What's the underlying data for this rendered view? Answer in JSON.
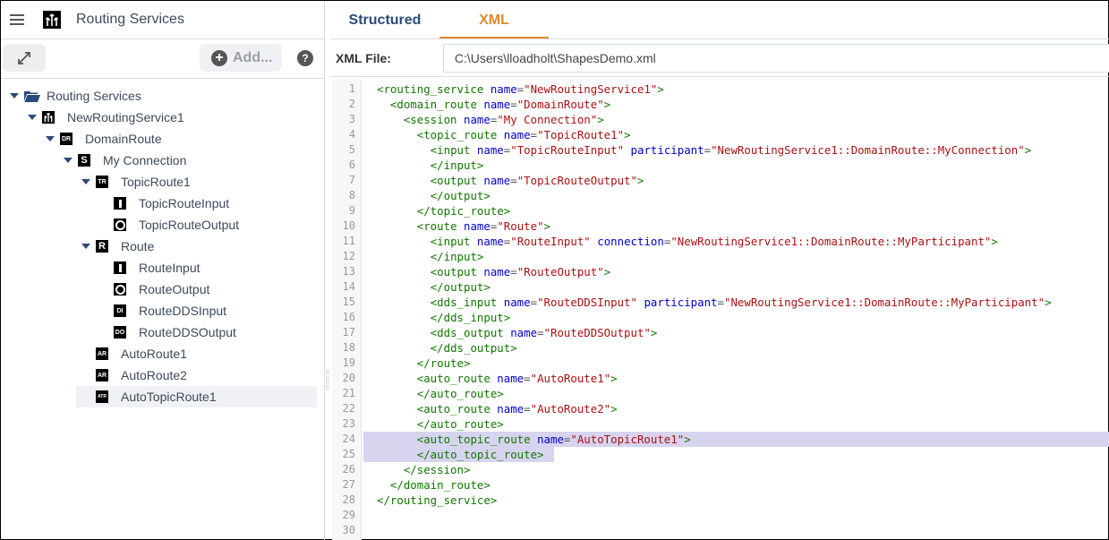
{
  "app": {
    "title": "Routing Services",
    "menu_icon": "hamburger-icon",
    "logo_icon": "routing-service-icon"
  },
  "toolbar": {
    "expand_icon": "expand-diagonal-icon",
    "add_label": "Add...",
    "add_icon": "plus-circle-icon",
    "help_icon": "question-icon",
    "help_glyph": "?",
    "add_glyph": "+"
  },
  "tree": [
    {
      "label": "Routing Services",
      "icon": "folder-open-icon",
      "badge": "",
      "expanded": true,
      "depth": 0
    },
    {
      "label": "NewRoutingService1",
      "icon": "routing-service-icon",
      "badge": "",
      "expanded": true,
      "depth": 1
    },
    {
      "label": "DomainRoute",
      "icon": "domain-route-icon",
      "badge": "DR",
      "expanded": true,
      "depth": 2
    },
    {
      "label": "My Connection",
      "icon": "session-icon",
      "badge": "S",
      "expanded": true,
      "depth": 3
    },
    {
      "label": "TopicRoute1",
      "icon": "topic-route-icon",
      "badge": "TR",
      "expanded": true,
      "depth": 4
    },
    {
      "label": "TopicRouteInput",
      "icon": "input-icon",
      "badge": "I",
      "depth": 5
    },
    {
      "label": "TopicRouteOutput",
      "icon": "output-icon",
      "badge": "O",
      "depth": 5
    },
    {
      "label": "Route",
      "icon": "route-icon",
      "badge": "R",
      "expanded": true,
      "depth": 4
    },
    {
      "label": "RouteInput",
      "icon": "input-icon",
      "badge": "I",
      "depth": 5
    },
    {
      "label": "RouteOutput",
      "icon": "output-icon",
      "badge": "O",
      "depth": 5
    },
    {
      "label": "RouteDDSInput",
      "icon": "dds-input-icon",
      "badge": "DI",
      "depth": 5
    },
    {
      "label": "RouteDDSOutput",
      "icon": "dds-output-icon",
      "badge": "DO",
      "depth": 5
    },
    {
      "label": "AutoRoute1",
      "icon": "auto-route-icon",
      "badge": "AR",
      "depth": 4
    },
    {
      "label": "AutoRoute2",
      "icon": "auto-route-icon",
      "badge": "AR",
      "depth": 4
    },
    {
      "label": "AutoTopicRoute1",
      "icon": "auto-topic-route-icon",
      "badge": "ATR",
      "depth": 4,
      "selected": true
    }
  ],
  "tabs": [
    {
      "label": "Structured",
      "active": false
    },
    {
      "label": "XML",
      "active": true
    }
  ],
  "file": {
    "label": "XML File:",
    "value": "C:\\Users\\lloadholt\\ShapesDemo.xml"
  },
  "editor": {
    "highlight_lines": [
      24,
      25
    ],
    "lines": [
      {
        "n": "1",
        "indent": 0,
        "tokens": [
          [
            "tg",
            "<routing_service"
          ],
          [
            "pn",
            " "
          ],
          [
            "at",
            "name"
          ],
          [
            "pn",
            "="
          ],
          [
            "st",
            "\"NewRoutingService1\""
          ],
          [
            "tg",
            ">"
          ]
        ]
      },
      {
        "n": "2",
        "indent": 1,
        "tokens": [
          [
            "tg",
            "<domain_route"
          ],
          [
            "pn",
            " "
          ],
          [
            "at",
            "name"
          ],
          [
            "pn",
            "="
          ],
          [
            "st",
            "\"DomainRoute\""
          ],
          [
            "tg",
            ">"
          ]
        ]
      },
      {
        "n": "3",
        "indent": 2,
        "tokens": [
          [
            "tg",
            "<session"
          ],
          [
            "pn",
            " "
          ],
          [
            "at",
            "name"
          ],
          [
            "pn",
            "="
          ],
          [
            "st",
            "\"My Connection\""
          ],
          [
            "tg",
            ">"
          ]
        ]
      },
      {
        "n": "4",
        "indent": 3,
        "tokens": [
          [
            "tg",
            "<topic_route"
          ],
          [
            "pn",
            " "
          ],
          [
            "at",
            "name"
          ],
          [
            "pn",
            "="
          ],
          [
            "st",
            "\"TopicRoute1\""
          ],
          [
            "tg",
            ">"
          ]
        ]
      },
      {
        "n": "5",
        "indent": 4,
        "tokens": [
          [
            "tg",
            "<input"
          ],
          [
            "pn",
            " "
          ],
          [
            "at",
            "name"
          ],
          [
            "pn",
            "="
          ],
          [
            "st",
            "\"TopicRouteInput\""
          ],
          [
            "pn",
            " "
          ],
          [
            "at",
            "participant"
          ],
          [
            "pn",
            "="
          ],
          [
            "st",
            "\"NewRoutingService1::DomainRoute::MyConnection\""
          ],
          [
            "tg",
            ">"
          ]
        ]
      },
      {
        "n": "6",
        "indent": 4,
        "tokens": [
          [
            "tg",
            "</input>"
          ]
        ]
      },
      {
        "n": "7",
        "indent": 4,
        "tokens": [
          [
            "tg",
            "<output"
          ],
          [
            "pn",
            " "
          ],
          [
            "at",
            "name"
          ],
          [
            "pn",
            "="
          ],
          [
            "st",
            "\"TopicRouteOutput\""
          ],
          [
            "tg",
            ">"
          ]
        ]
      },
      {
        "n": "8",
        "indent": 4,
        "tokens": [
          [
            "tg",
            "</output>"
          ]
        ]
      },
      {
        "n": "9",
        "indent": 3,
        "tokens": [
          [
            "tg",
            "</topic_route>"
          ]
        ]
      },
      {
        "n": "10",
        "indent": 3,
        "tokens": [
          [
            "tg",
            "<route"
          ],
          [
            "pn",
            " "
          ],
          [
            "at",
            "name"
          ],
          [
            "pn",
            "="
          ],
          [
            "st",
            "\"Route\""
          ],
          [
            "tg",
            ">"
          ]
        ]
      },
      {
        "n": "11",
        "indent": 4,
        "tokens": [
          [
            "tg",
            "<input"
          ],
          [
            "pn",
            " "
          ],
          [
            "at",
            "name"
          ],
          [
            "pn",
            "="
          ],
          [
            "st",
            "\"RouteInput\""
          ],
          [
            "pn",
            " "
          ],
          [
            "at",
            "connection"
          ],
          [
            "pn",
            "="
          ],
          [
            "st",
            "\"NewRoutingService1::DomainRoute::MyParticipant\""
          ],
          [
            "tg",
            ">"
          ]
        ]
      },
      {
        "n": "12",
        "indent": 4,
        "tokens": [
          [
            "tg",
            "</input>"
          ]
        ]
      },
      {
        "n": "13",
        "indent": 4,
        "tokens": [
          [
            "tg",
            "<output"
          ],
          [
            "pn",
            " "
          ],
          [
            "at",
            "name"
          ],
          [
            "pn",
            "="
          ],
          [
            "st",
            "\"RouteOutput\""
          ],
          [
            "tg",
            ">"
          ]
        ]
      },
      {
        "n": "14",
        "indent": 4,
        "tokens": [
          [
            "tg",
            "</output>"
          ]
        ]
      },
      {
        "n": "15",
        "indent": 4,
        "tokens": [
          [
            "tg",
            "<dds_input"
          ],
          [
            "pn",
            " "
          ],
          [
            "at",
            "name"
          ],
          [
            "pn",
            "="
          ],
          [
            "st",
            "\"RouteDDSInput\""
          ],
          [
            "pn",
            " "
          ],
          [
            "at",
            "participant"
          ],
          [
            "pn",
            "="
          ],
          [
            "st",
            "\"NewRoutingService1::DomainRoute::MyParticipant\""
          ],
          [
            "tg",
            ">"
          ]
        ]
      },
      {
        "n": "16",
        "indent": 4,
        "tokens": [
          [
            "tg",
            "</dds_input>"
          ]
        ]
      },
      {
        "n": "17",
        "indent": 4,
        "tokens": [
          [
            "tg",
            "<dds_output"
          ],
          [
            "pn",
            " "
          ],
          [
            "at",
            "name"
          ],
          [
            "pn",
            "="
          ],
          [
            "st",
            "\"RouteDDSOutput\""
          ],
          [
            "tg",
            ">"
          ]
        ]
      },
      {
        "n": "18",
        "indent": 4,
        "tokens": [
          [
            "tg",
            "</dds_output>"
          ]
        ]
      },
      {
        "n": "19",
        "indent": 3,
        "tokens": [
          [
            "tg",
            "</route>"
          ]
        ]
      },
      {
        "n": "20",
        "indent": 3,
        "tokens": [
          [
            "tg",
            "<auto_route"
          ],
          [
            "pn",
            " "
          ],
          [
            "at",
            "name"
          ],
          [
            "pn",
            "="
          ],
          [
            "st",
            "\"AutoRoute1\""
          ],
          [
            "tg",
            ">"
          ]
        ]
      },
      {
        "n": "21",
        "indent": 3,
        "tokens": [
          [
            "tg",
            "</auto_route>"
          ]
        ]
      },
      {
        "n": "22",
        "indent": 3,
        "tokens": [
          [
            "tg",
            "<auto_route"
          ],
          [
            "pn",
            " "
          ],
          [
            "at",
            "name"
          ],
          [
            "pn",
            "="
          ],
          [
            "st",
            "\"AutoRoute2\""
          ],
          [
            "tg",
            ">"
          ]
        ]
      },
      {
        "n": "23",
        "indent": 3,
        "tokens": [
          [
            "tg",
            "</auto_route>"
          ]
        ]
      },
      {
        "n": "24",
        "indent": 3,
        "tokens": [
          [
            "tg",
            "<auto_topic_route"
          ],
          [
            "pn",
            " "
          ],
          [
            "at",
            "name"
          ],
          [
            "pn",
            "="
          ],
          [
            "st",
            "\"AutoTopicRoute1\""
          ],
          [
            "tg",
            ">"
          ]
        ]
      },
      {
        "n": "25",
        "indent": 3,
        "tokens": [
          [
            "tg",
            "</auto_topic_route>"
          ]
        ]
      },
      {
        "n": "26",
        "indent": 2,
        "tokens": [
          [
            "tg",
            "</session>"
          ]
        ]
      },
      {
        "n": "27",
        "indent": 1,
        "tokens": [
          [
            "tg",
            "</domain_route>"
          ]
        ]
      },
      {
        "n": "28",
        "indent": 0,
        "tokens": [
          [
            "tg",
            "</routing_service>"
          ]
        ]
      },
      {
        "n": "29",
        "indent": 0,
        "tokens": []
      },
      {
        "n": "30",
        "indent": 0,
        "tokens": []
      }
    ]
  }
}
